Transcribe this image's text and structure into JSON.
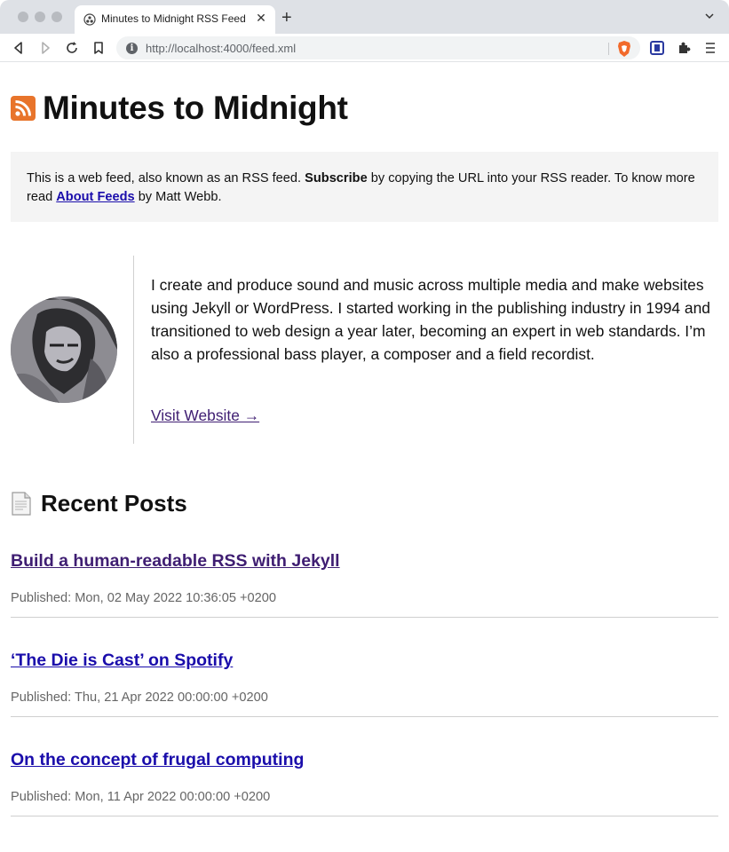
{
  "browser": {
    "tab_title": "Minutes to Midnight RSS Feed",
    "tab_close": "✕",
    "new_tab": "+",
    "url": "http://localhost:4000/feed.xml",
    "info_glyph": "i"
  },
  "header": {
    "title": "Minutes to Midnight"
  },
  "notice": {
    "text_1": "This is a web feed, also known as an RSS feed. ",
    "bold": "Subscribe",
    "text_2": " by copying the URL into your RSS reader. To know more read ",
    "link": "About Feeds",
    "text_3": " by Matt Webb."
  },
  "author": {
    "bio": "I create and produce sound and music across multiple media and make websites using Jekyll or WordPress. I started working in the publishing industry in 1994 and transitioned to web design a year later, becoming an expert in web standards. I’m also a professional bass player, a composer and a field recordist.",
    "visit_label": "Visit Website →"
  },
  "recent": {
    "heading": "Recent Posts"
  },
  "posts": [
    {
      "title": "Build a human-readable RSS with Jekyll",
      "date": "Published: Mon, 02 May 2022 10:36:05 +0200",
      "visited": true
    },
    {
      "title": "‘The Die is Cast’ on Spotify",
      "date": "Published: Thu, 21 Apr 2022 00:00:00 +0200",
      "visited": false
    },
    {
      "title": "On the concept of frugal computing",
      "date": "Published: Mon, 11 Apr 2022 00:00:00 +0200",
      "visited": false
    }
  ],
  "colors": {
    "visited_link": "#3f1e72",
    "link": "#1a0dab",
    "rss_orange": "#e8742b"
  },
  "icons": {
    "back": "back-arrow-icon",
    "forward": "forward-arrow-icon",
    "reload": "reload-icon",
    "bookmark": "bookmark-icon",
    "brave": "brave-shield-icon",
    "extension": "extension-puzzle-icon",
    "menu": "menu-icon",
    "rss": "rss-icon",
    "document": "document-icon"
  }
}
